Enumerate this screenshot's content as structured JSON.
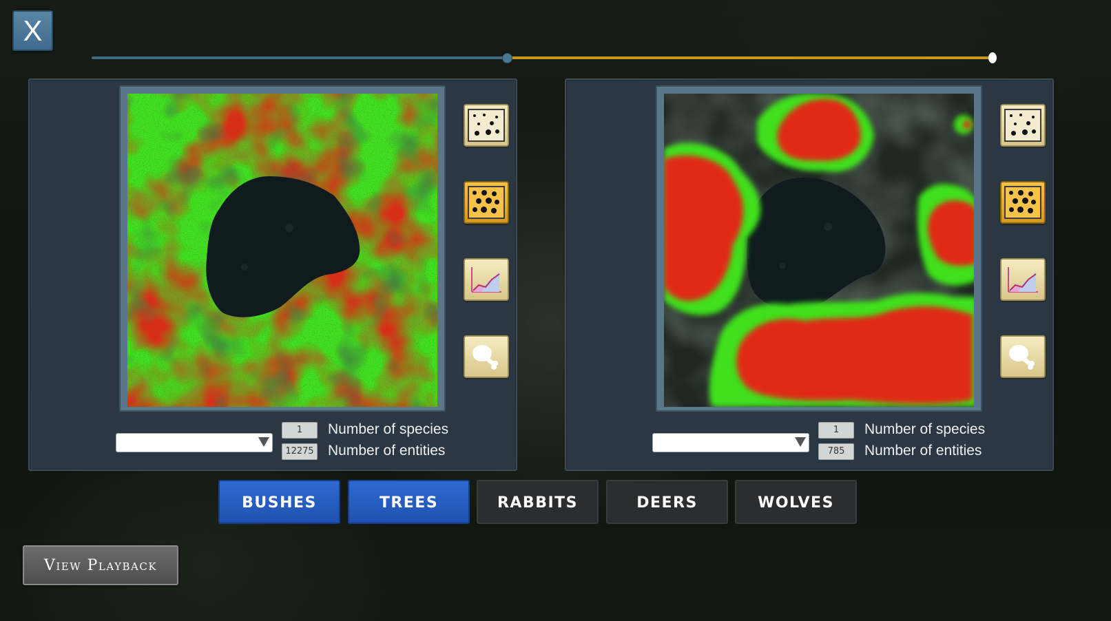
{
  "window": {
    "close_label": "X"
  },
  "timeline": {
    "progress": 0.46
  },
  "panels": [
    {
      "species_count": "1",
      "entities_count": "12275",
      "species_label": "Number of species",
      "entities_label": "Number of entities",
      "dropdown_value": "",
      "buttons": [
        {
          "icon": "scatter-sparse-icon",
          "active": false
        },
        {
          "icon": "scatter-dense-icon",
          "active": true
        },
        {
          "icon": "area-chart-icon",
          "active": false
        },
        {
          "icon": "meat-drumstick-icon",
          "active": false
        }
      ]
    },
    {
      "species_count": "1",
      "entities_count": "785",
      "species_label": "Number of species",
      "entities_label": "Number of entities",
      "dropdown_value": "",
      "buttons": [
        {
          "icon": "scatter-sparse-icon",
          "active": false
        },
        {
          "icon": "scatter-dense-icon",
          "active": true
        },
        {
          "icon": "area-chart-icon",
          "active": false
        },
        {
          "icon": "meat-drumstick-icon",
          "active": false
        }
      ]
    }
  ],
  "tabs": [
    {
      "label": "BUSHES",
      "active": true
    },
    {
      "label": "TREES",
      "active": true
    },
    {
      "label": "RABBITS",
      "active": false
    },
    {
      "label": "DEERS",
      "active": false
    },
    {
      "label": "WOLVES",
      "active": false
    }
  ],
  "playback": {
    "label": "View Playback"
  },
  "colors": {
    "heat_high": "#e02a14",
    "heat_low": "#3fe01e",
    "tab_active": "#2360c4",
    "tab_inactive": "#2b2d2e",
    "timeline_done": "#3f6b82",
    "timeline_remaining": "#c8961e"
  }
}
